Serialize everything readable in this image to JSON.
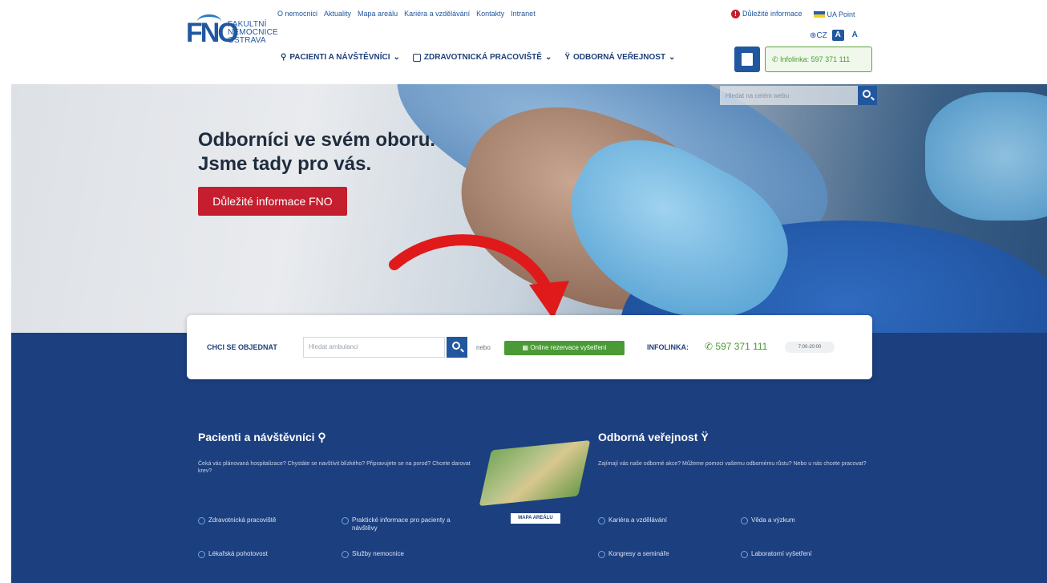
{
  "logo": {
    "mark": "FNO",
    "line1": "FAKULTNÍ",
    "line2": "NEMOCNICE",
    "line3": "OSTRAVA"
  },
  "top_links": [
    "O nemocnici",
    "Aktuality",
    "Mapa areálu",
    "Kariéra a vzdělávání",
    "Kontakty",
    "Intranet"
  ],
  "right_links": {
    "important": "Důležité informace",
    "ua": "UA Point"
  },
  "lang": {
    "code": "CZ",
    "font_a": "A",
    "font_b": "A"
  },
  "main_nav": [
    "PACIENTI A NÁVŠTĚVNÍCI",
    "ZDRAVOTNICKÁ PRACOVIŠTĚ",
    "ODBORNÁ VEŘEJNOST"
  ],
  "infoline_btn": "Infolinka: 597 371 111",
  "hero": {
    "title_line1": "Odborníci ve svém oboru.",
    "title_line2": "Jsme tady pro vás.",
    "button": "Důležité informace FNO",
    "search_placeholder": "Hledat na celém webu"
  },
  "booking": {
    "label": "CHCI SE OBJEDNAT",
    "search_placeholder": "Hledat ambulanci",
    "or": "nebo",
    "online_button": "Online rezervace vyšetření",
    "infoline_label": "INFOLINKA:",
    "phone": "597 371 111",
    "hours": "7:00-20:00"
  },
  "patients": {
    "title": "Pacienti a návštěvníci",
    "desc": "Čeká vás plánovaná hospitalizace? Chystáte se navštívit blízkého? Připravujete se na porod? Chcete darovat krev?",
    "links": [
      "Zdravotnická pracoviště",
      "Praktické informace pro pacienty a návštěvy",
      "Lékařská pohotovost",
      "Služby nemocnice"
    ]
  },
  "map_label": "MAPA AREÁLU",
  "professional": {
    "title": "Odborná veřejnost",
    "desc": "Zajímají vás naše odborné akce? Můžeme pomoci vašemu odbornému růstu? Nebo u nás chcete pracovat?",
    "links": [
      "Kariéra a vzdělávání",
      "Věda a výzkum",
      "Kongresy a semináře",
      "Laboratorní vyšetření"
    ]
  },
  "colors": {
    "brand_blue": "#1c3f7f",
    "red": "#c51f2f",
    "green": "#4a9a35"
  },
  "icons": [
    "info-icon",
    "ua-flag-icon",
    "globe-icon",
    "person-icon",
    "cross-box-icon",
    "stethoscope-icon",
    "phone-icon",
    "search-icon",
    "calendar-icon",
    "arrow-icon",
    "circle-chevron-icon"
  ]
}
